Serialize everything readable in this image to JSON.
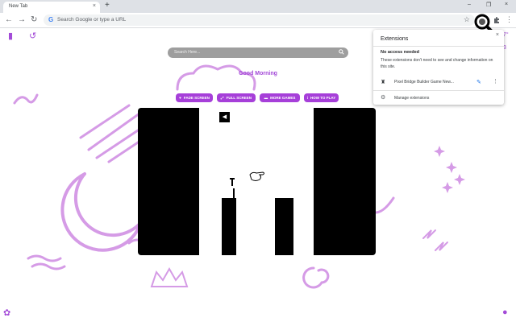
{
  "browser": {
    "tab_title": "New Tab",
    "tab_close": "×",
    "new_tab": "+",
    "minimize": "–",
    "restore": "❐",
    "close": "×",
    "back": "←",
    "forward": "→",
    "reload": "↻",
    "omnibox_placeholder": "Search Google or type a URL",
    "bookmark_star": "☆",
    "extensions_icon": "puzzle-icon",
    "menu": "⋮"
  },
  "page": {
    "search_placeholder": "Search Here...",
    "greeting": "Good Morning",
    "buttons": [
      {
        "icon": "♥",
        "label": "FADE SCREEN"
      },
      {
        "icon": "⤢",
        "label": "FULL SCREEN"
      },
      {
        "icon": "▬",
        "label": "MORE GAMES"
      },
      {
        "icon": "i",
        "label": "HOW TO PLAY"
      }
    ],
    "play_button": "◀",
    "weather_temp": "7°",
    "weather_value": "3",
    "accent_color": "#a63fd9"
  },
  "extensions_popup": {
    "title": "Extensions",
    "close": "×",
    "access_heading": "No access needed",
    "access_desc": "These extensions don't need to see and change information on this site.",
    "extension_name": "Pixel Bridge Builder Game New...",
    "pin": "📌",
    "more": "⋮",
    "gear": "⚙",
    "manage_label": "Manage extensions"
  }
}
